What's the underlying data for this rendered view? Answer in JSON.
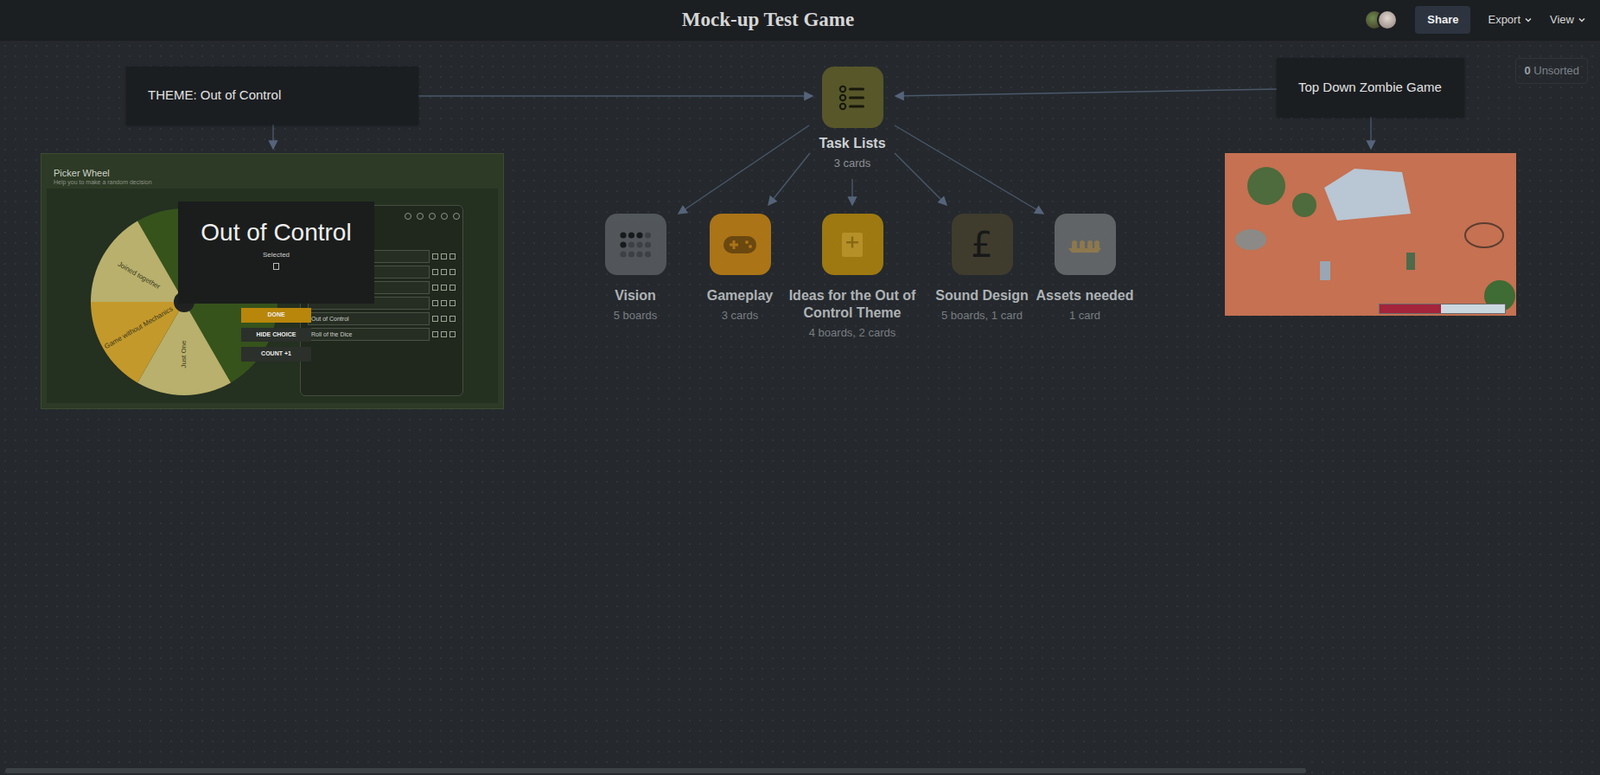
{
  "header": {
    "title": "Mock-up Test Game",
    "share": "Share",
    "export": "Export",
    "view": "View"
  },
  "unsorted": {
    "count": "0",
    "label": "Unsorted"
  },
  "notes": [
    {
      "text": "THEME: Out of Control"
    },
    {
      "text": "Top Down Zombie Game"
    }
  ],
  "hub": {
    "label": "Task Lists",
    "count": "3 cards"
  },
  "boards": [
    {
      "label": "Vision",
      "count": "5 boards",
      "kind": "dots",
      "color": "#5d6165"
    },
    {
      "label": "Gameplay",
      "count": "3 cards",
      "kind": "gamepad",
      "color": "#c98512"
    },
    {
      "label": "Ideas for the Out of Control Theme",
      "count": "4 boards, 2 cards",
      "kind": "note",
      "color": "#b98b0b"
    },
    {
      "label": "Sound Design",
      "count": "5 boards, 1 card",
      "kind": "glyph",
      "glyph": "£",
      "color": "#45412e"
    },
    {
      "label": "Assets needed",
      "count": "1 card",
      "kind": "boats",
      "color": "#6f7274"
    }
  ],
  "picker": {
    "title": "Picker Wheel",
    "subtitle": "Help you to make a random decision",
    "result": "Out of Control",
    "caption": "Selected",
    "buttons": [
      "DONE",
      "HIDE CHOICE",
      "COUNT +1"
    ],
    "wheel": [
      {
        "color": "#36531c"
      },
      {
        "color": "#b8b06c"
      },
      {
        "color": "#36531c"
      },
      {
        "label": "Just One",
        "color": "#b8b06c"
      },
      {
        "label": "Game without Mechanics",
        "color": "#c4992b"
      },
      {
        "label": "Joined together",
        "color": "#b8b06c"
      }
    ],
    "list": [
      "Out of Control",
      "Roll of the Dice"
    ]
  },
  "game_frame": {
    "health": 0.49
  }
}
